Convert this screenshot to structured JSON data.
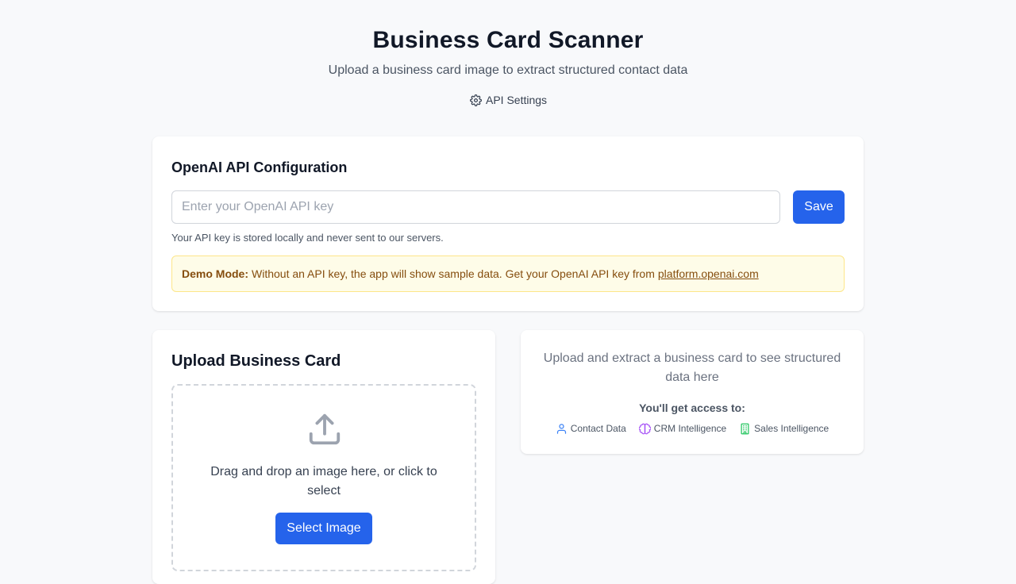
{
  "header": {
    "title": "Business Card Scanner",
    "subtitle": "Upload a business card image to extract structured contact data",
    "settings_label": "API Settings",
    "settings_icon": "gear-icon"
  },
  "config": {
    "title": "OpenAI API Configuration",
    "input_placeholder": "Enter your OpenAI API key",
    "input_value": "",
    "save_label": "Save",
    "help_text": "Your API key is stored locally and never sent to our servers.",
    "demo_label": "Demo Mode:",
    "demo_text": "Without an API key, the app will show sample data. Get your OpenAI API key from",
    "demo_link": "platform.openai.com"
  },
  "upload": {
    "title": "Upload Business Card",
    "upload_icon": "upload-icon",
    "drop_text": "Drag and drop an image here, or click to select",
    "select_label": "Select Image"
  },
  "results": {
    "empty_text": "Upload and extract a business card to see structured data here",
    "access_title": "You'll get access to:",
    "features": [
      {
        "label": "Contact Data",
        "icon": "user-icon",
        "color": "#3b82f6"
      },
      {
        "label": "CRM Intelligence",
        "icon": "brain-icon",
        "color": "#a855f7"
      },
      {
        "label": "Sales Intelligence",
        "icon": "building-icon",
        "color": "#22c55e"
      }
    ]
  },
  "colors": {
    "primary": "#2563eb",
    "background": "#f8f9fb",
    "demo_bg": "#fefce8",
    "demo_text": "#854d0e"
  }
}
